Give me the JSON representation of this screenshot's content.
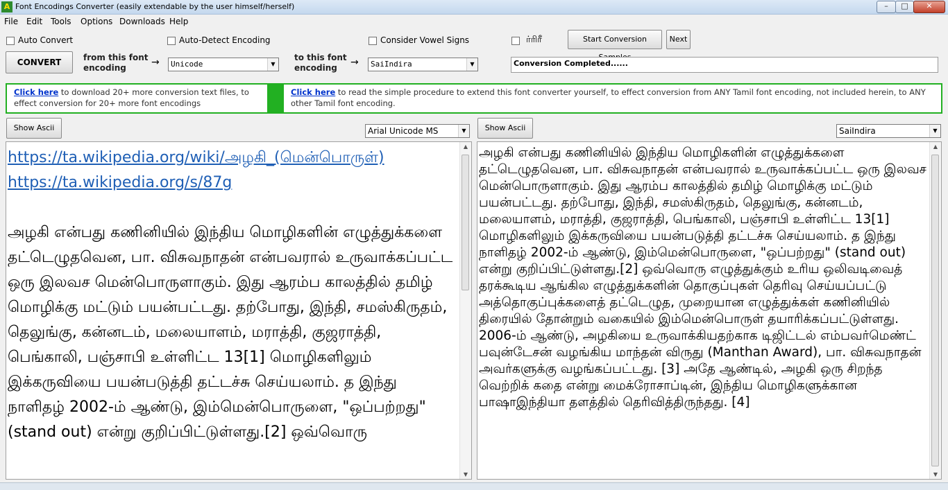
{
  "window": {
    "title": "Font Encodings Converter (easily extendable by the user himself/herself)",
    "app_icon": "A"
  },
  "menu": [
    "File",
    "Edit",
    "Tools",
    "Options",
    "Downloads",
    "Help"
  ],
  "controls": {
    "auto_convert": "Auto Convert",
    "auto_detect": "Auto-Detect Encoding",
    "consider_vowel": "Consider Vowel Signs",
    "vowel_sample": "ர்ரிரீ",
    "start_samples": "Start Conversion Samples",
    "next": "Next",
    "convert": "CONVERT",
    "from_label": "from this font encoding",
    "from_arrow": "→",
    "from_value": "Unicode",
    "to_label": "to this font encoding",
    "to_arrow": "→",
    "to_value": "SaiIndira",
    "status": "Conversion Completed......"
  },
  "info": {
    "left_link": "Click here",
    "left_text": " to download 20+ more conversion text files, to effect conversion for 20+ more font encodings",
    "right_link": "Click here",
    "right_text": " to read the simple procedure to extend this font converter yourself, to effect conversion from ANY Tamil font encoding, not included herein, to ANY other Tamil font encoding."
  },
  "left_pane": {
    "show_ascii": "Show Ascii",
    "font": "Arial Unicode MS",
    "url1": "https://ta.wikipedia.org/wiki/அழகி_(மென்பொருள்)",
    "url2": "https://ta.wikipedia.org/s/87g",
    "body": "அழகி என்பது கணினியில் இந்திய மொழிகளின் எழுத்துக்களை தட்டெழுதவென, பா. விசுவநாதன் என்பவரால் உருவாக்கப்பட்ட ஒரு இலவச மென்பொருளாகும். இது ஆரம்ப காலத்தில் தமிழ் மொழிக்கு மட்டும் பயன்பட்டது. தற்போது, இந்தி, சமஸ்கிருதம், தெலுங்கு, கன்னடம், மலையாளம், மராத்தி, குஜராத்தி, பெங்காலி, பஞ்சாபி உள்ளிட்ட 13[1] மொழிகளிலும் இக்கருவியை பயன்படுத்தி தட்டச்சு செய்யலாம். த இந்து நாளிதழ் 2002-ம் ஆண்டு, இம்மென்பொருளை, \"ஒப்பற்றது\" (stand out) என்று குறிப்பிட்டுள்ளது.[2] ஒவ்வொரு"
  },
  "right_pane": {
    "show_ascii": "Show Ascii",
    "font": "SaiIndira",
    "body": "அழகி என்பது கணினியில் இந்திய மொழிகளின் எழுத்துக்களை தட்டெழுதவென, பா. விசுவநாதன் என்பவரால் உருவாக்கப்பட்ட ஒரு இலவச மென்பொருளாகும். இது ஆரம்ப காலத்தில் தமிழ் மொழிக்கு மட்டும் பயன்பட்டது. தற்போது, இந்தி, சமஸ்கிருதம், தெலுங்கு, கன்னடம், மலையாளம், மராத்தி, குஜராத்தி, பெங்காலி, பஞ்சாபி உள்ளிட்ட 13[1] மொழிகளிலும் இக்கருவியை பயன்படுத்தி தட்டச்சு செய்யலாம். த இந்து நாளிதழ் 2002-ம் ஆண்டு, இம்மென்பொருளை, \"ஒப்பற்றது\" (stand out) என்று குறிப்பிட்டுள்ளது.[2] ஒவ்வொரு எழுத்துக்கும் உரிய ஒலிவடிவைத் தரக்கூடிய ஆங்கில எழுத்துக்களின் தொகுப்புகள் தெரிவு செய்யப்பட்டு அத்தொகுப்புக்களைத் தட்டெழுத, முறையான எழுத்துக்கள் கணினியில் திரையில் தோன்றும் வகையில் இம்மென்பொருள் தயாரிக்கப்பட்டுள்ளது. 2006-ம் ஆண்டு, அழகியை உருவாக்கியதற்காக டிஜிட்டல் எம்பவர்மெண்ட் பவுன்டேசன் வழங்கிய மாந்தன் விருது (Manthan Award), பா. விசுவநாதன் அவர்களுக்கு வழங்கப்பட்டது. [3] அதே ஆண்டில், அழகி ஒரு சிறந்த வெற்றிக் கதை என்று மைக்ரோசாப்டின், இந்திய மொழிகளுக்கான பாஷாஇந்தியா தளத்தில் தெரிவித்திருந்தது. [4]"
  },
  "colors": {
    "accent_green": "#22b022",
    "link_blue": "#0033cc"
  }
}
